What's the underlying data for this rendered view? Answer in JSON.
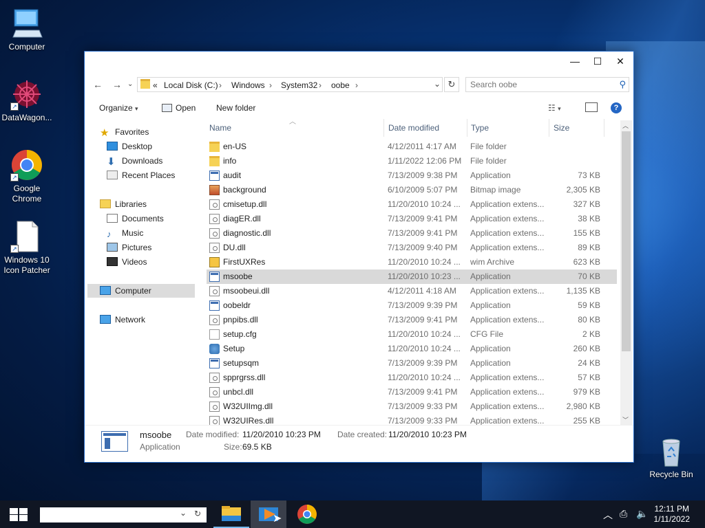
{
  "desktop": {
    "icons": [
      {
        "label": "Computer",
        "icon": "computer-icon"
      },
      {
        "label": "DataWagon...",
        "icon": "datawagon-icon"
      },
      {
        "label": "Google Chrome",
        "icon": "chrome-icon"
      },
      {
        "label": "Windows 10 Icon Patcher",
        "icon": "file-icon"
      },
      {
        "label": "Recycle Bin",
        "icon": "recycle-bin-icon"
      }
    ]
  },
  "window": {
    "controls": {
      "minimize": "—",
      "maximize": "☐",
      "close": "✕"
    },
    "address": {
      "prefix": "«",
      "crumbs": [
        "Local Disk (C:)",
        "Windows",
        "System32",
        "oobe"
      ],
      "separator": "›"
    },
    "search": {
      "placeholder": "Search oobe"
    },
    "toolbar": {
      "organize": "Organize",
      "open": "Open",
      "new_folder": "New folder"
    },
    "nav": {
      "favorites": "Favorites",
      "desktop": "Desktop",
      "downloads": "Downloads",
      "recent": "Recent Places",
      "libraries": "Libraries",
      "documents": "Documents",
      "music": "Music",
      "pictures": "Pictures",
      "videos": "Videos",
      "computer": "Computer",
      "network": "Network"
    },
    "columns": {
      "name": "Name",
      "date": "Date modified",
      "type": "Type",
      "size": "Size"
    },
    "files": [
      {
        "name": "en-US",
        "date": "4/12/2011 4:17 AM",
        "type": "File folder",
        "size": "",
        "icon": "folder"
      },
      {
        "name": "info",
        "date": "1/11/2022 12:06 PM",
        "type": "File folder",
        "size": "",
        "icon": "folder"
      },
      {
        "name": "audit",
        "date": "7/13/2009 9:38 PM",
        "type": "Application",
        "size": "73 KB",
        "icon": "app"
      },
      {
        "name": "background",
        "date": "6/10/2009 5:07 PM",
        "type": "Bitmap image",
        "size": "2,305 KB",
        "icon": "img"
      },
      {
        "name": "cmisetup.dll",
        "date": "11/20/2010 10:24 ...",
        "type": "Application extens...",
        "size": "327 KB",
        "icon": "dll"
      },
      {
        "name": "diagER.dll",
        "date": "7/13/2009 9:41 PM",
        "type": "Application extens...",
        "size": "38 KB",
        "icon": "dll"
      },
      {
        "name": "diagnostic.dll",
        "date": "7/13/2009 9:41 PM",
        "type": "Application extens...",
        "size": "155 KB",
        "icon": "dll"
      },
      {
        "name": "DU.dll",
        "date": "7/13/2009 9:40 PM",
        "type": "Application extens...",
        "size": "89 KB",
        "icon": "dll"
      },
      {
        "name": "FirstUXRes",
        "date": "11/20/2010 10:24 ...",
        "type": "wim Archive",
        "size": "623 KB",
        "icon": "wim"
      },
      {
        "name": "msoobe",
        "date": "11/20/2010 10:23 ...",
        "type": "Application",
        "size": "70 KB",
        "icon": "app",
        "selected": true
      },
      {
        "name": "msoobeui.dll",
        "date": "4/12/2011 4:18 AM",
        "type": "Application extens...",
        "size": "1,135 KB",
        "icon": "dll"
      },
      {
        "name": "oobeldr",
        "date": "7/13/2009 9:39 PM",
        "type": "Application",
        "size": "59 KB",
        "icon": "app"
      },
      {
        "name": "pnpibs.dll",
        "date": "7/13/2009 9:41 PM",
        "type": "Application extens...",
        "size": "80 KB",
        "icon": "dll"
      },
      {
        "name": "setup.cfg",
        "date": "11/20/2010 10:24 ...",
        "type": "CFG File",
        "size": "2 KB",
        "icon": "file"
      },
      {
        "name": "Setup",
        "date": "11/20/2010 10:24 ...",
        "type": "Application",
        "size": "260 KB",
        "icon": "setup"
      },
      {
        "name": "setupsqm",
        "date": "7/13/2009 9:39 PM",
        "type": "Application",
        "size": "24 KB",
        "icon": "app"
      },
      {
        "name": "spprgrss.dll",
        "date": "11/20/2010 10:24 ...",
        "type": "Application extens...",
        "size": "57 KB",
        "icon": "dll"
      },
      {
        "name": "unbcl.dll",
        "date": "7/13/2009 9:41 PM",
        "type": "Application extens...",
        "size": "979 KB",
        "icon": "dll"
      },
      {
        "name": "W32UIImg.dll",
        "date": "7/13/2009 9:33 PM",
        "type": "Application extens...",
        "size": "2,980 KB",
        "icon": "dll"
      },
      {
        "name": "W32UIRes.dll",
        "date": "7/13/2009 9:33 PM",
        "type": "Application extens...",
        "size": "255 KB",
        "icon": "dll"
      }
    ],
    "details": {
      "name": "msoobe",
      "kind": "Application",
      "modified_label": "Date modified:",
      "modified_value": "11/20/2010 10:23 PM",
      "created_label": "Date created:",
      "created_value": "11/20/2010 10:23 PM",
      "size_label": "Size:",
      "size_value": "69.5 KB"
    }
  },
  "taskbar": {
    "time": "12:11 PM",
    "date": "1/11/2022",
    "apps": [
      "file-explorer-icon",
      "media-player-icon",
      "chrome-icon"
    ]
  },
  "colors": {
    "accent": "#2a6fc9",
    "selection": "#d9d9d9",
    "taskbar": "#101623"
  }
}
